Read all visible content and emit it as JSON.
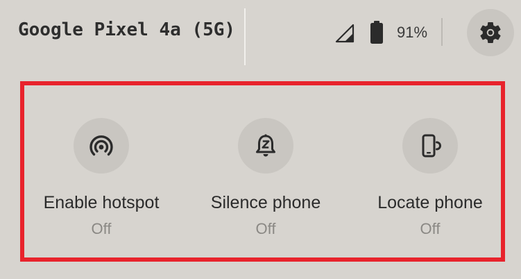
{
  "status_bar": {
    "device_name": "Google Pixel 4a (5G)",
    "battery_percent": "91%",
    "signal_icon": "signal-icon",
    "battery_icon": "battery-icon",
    "settings_icon": "gear-icon"
  },
  "tiles": [
    {
      "label": "Enable hotspot",
      "state": "Off",
      "icon": "hotspot-icon"
    },
    {
      "label": "Silence phone",
      "state": "Off",
      "icon": "silent-bell-icon"
    },
    {
      "label": "Locate phone",
      "state": "Off",
      "icon": "locate-phone-icon"
    }
  ],
  "colors": {
    "background": "#d7d4cf",
    "highlight": "#e8232c",
    "icon_circle": "#c9c6c1",
    "icon": "#2b2b2b",
    "state_text": "#8a8884"
  }
}
